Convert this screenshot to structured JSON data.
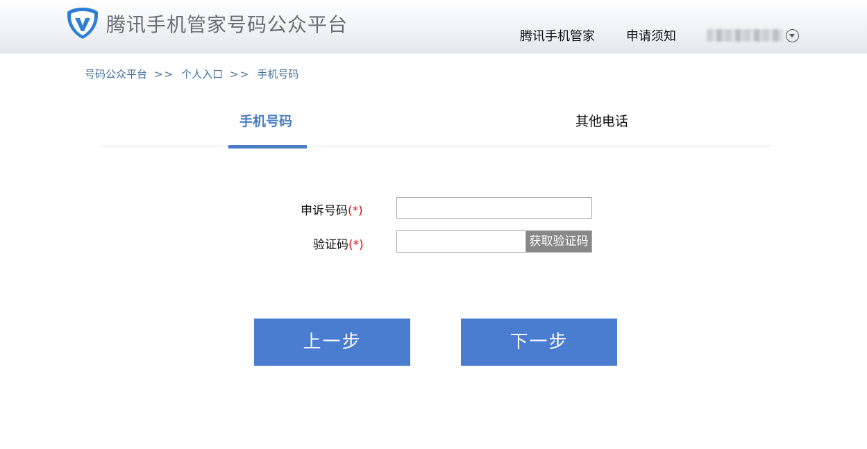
{
  "header": {
    "site_title": "腾讯手机管家号码公众平台",
    "nav": [
      "腾讯手机管家",
      "申请须知"
    ],
    "logo_icon": "shield-v-icon",
    "brand_color": "#2f7fd8"
  },
  "breadcrumb": {
    "items": [
      "号码公众平台",
      "个人入口",
      "手机号码"
    ],
    "separator": ">>"
  },
  "tabs": [
    {
      "label": "手机号码",
      "active": true
    },
    {
      "label": "其他电话",
      "active": false
    }
  ],
  "form": {
    "phone_label": "申诉号码",
    "code_label": "验证码",
    "required_mark": "(*)",
    "phone_value": "",
    "code_value": "",
    "get_code_label": "获取验证码"
  },
  "buttons": {
    "prev_label": "上一步",
    "next_label": "下一步"
  },
  "colors": {
    "accent": "#4a7cc4",
    "button": "#4a7ccf",
    "get_code_button": "#888888",
    "required": "#dd1111",
    "breadcrumb": "#3f6f9b"
  }
}
